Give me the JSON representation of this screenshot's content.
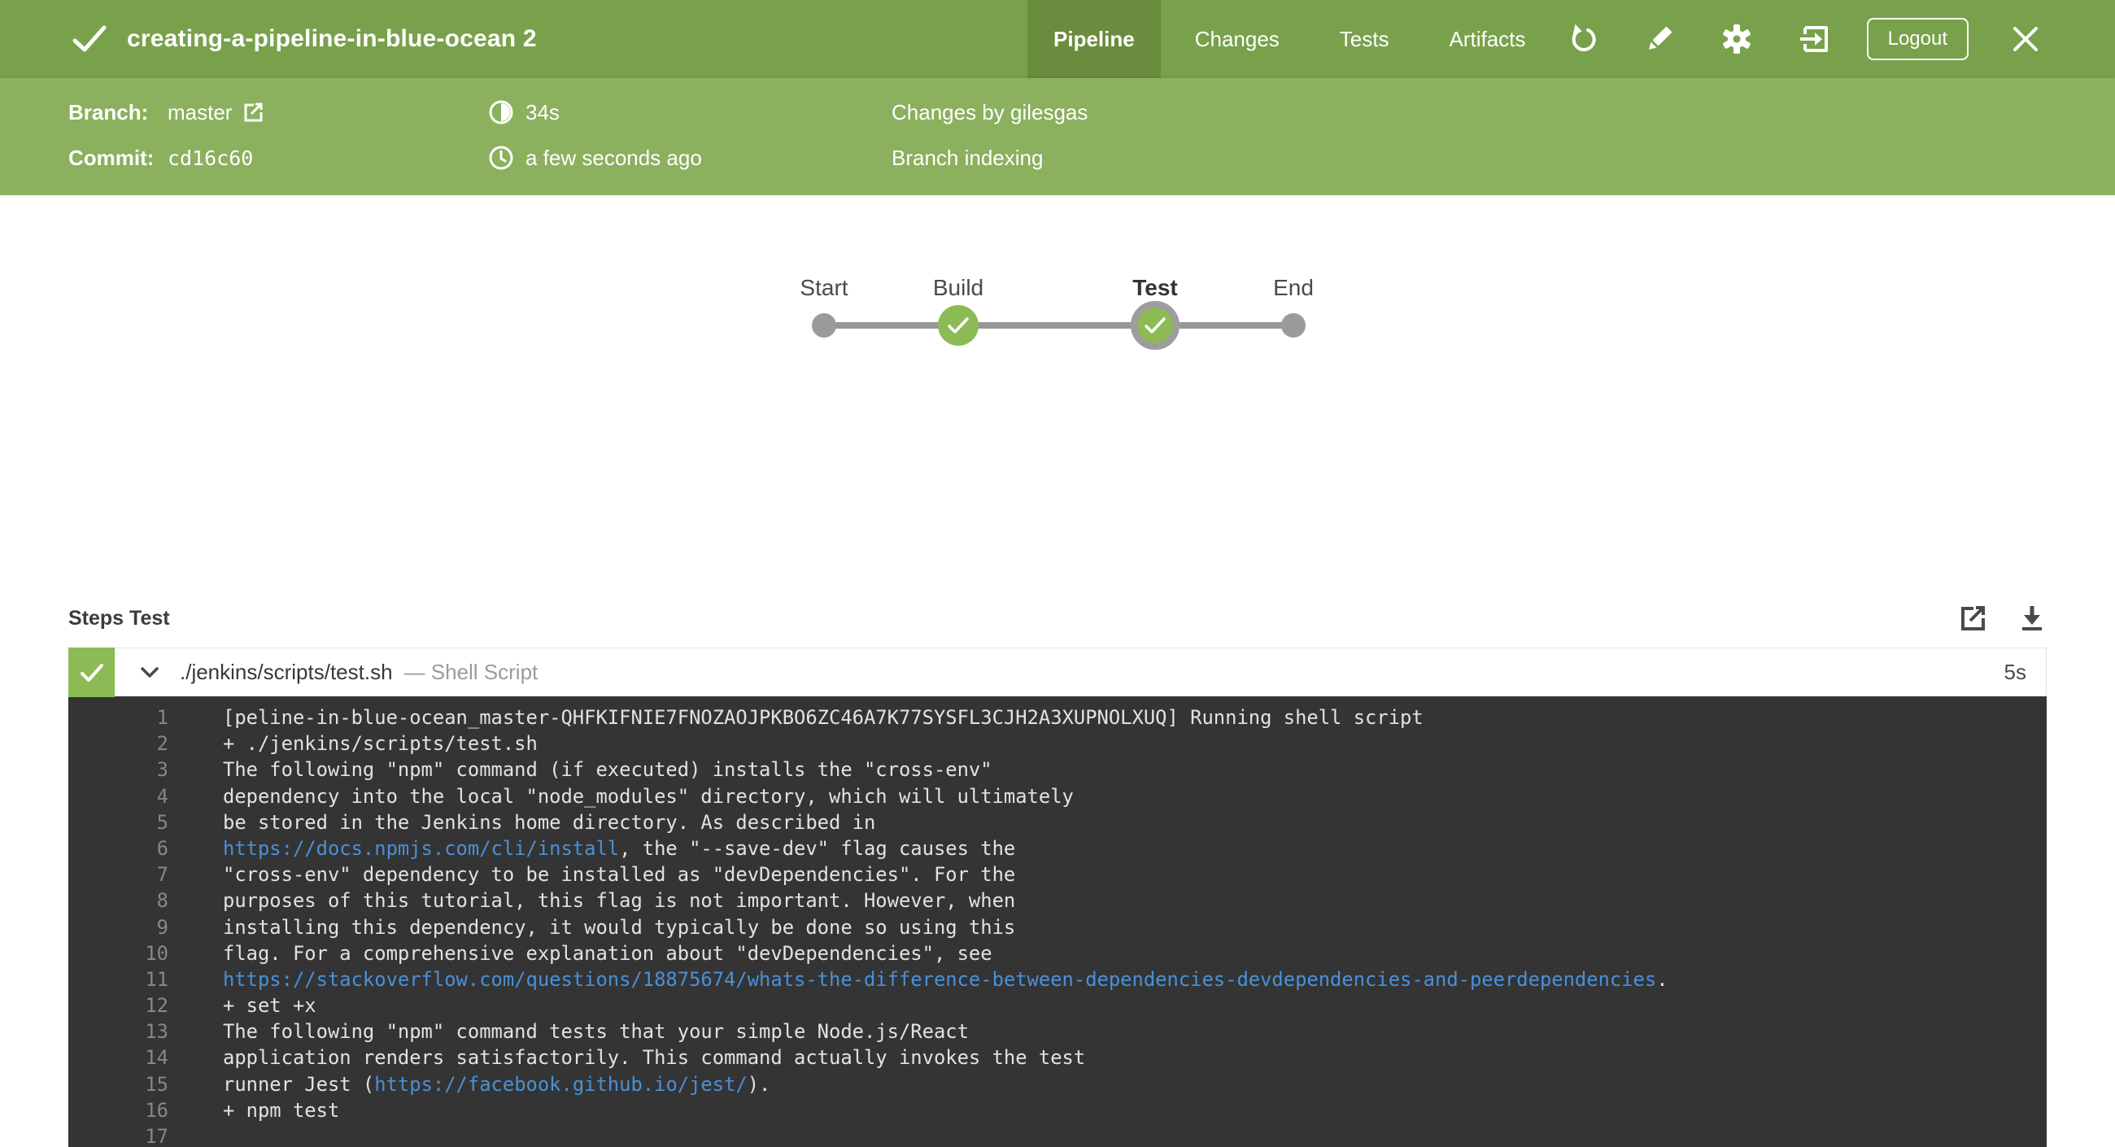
{
  "header": {
    "title": "creating-a-pipeline-in-blue-ocean 2",
    "tabs": [
      {
        "label": "Pipeline",
        "active": true
      },
      {
        "label": "Changes",
        "active": false
      },
      {
        "label": "Tests",
        "active": false
      },
      {
        "label": "Artifacts",
        "active": false
      }
    ],
    "logout_label": "Logout"
  },
  "run_info": {
    "branch_label": "Branch:",
    "branch_value": "master",
    "commit_label": "Commit:",
    "commit_value": "cd16c60",
    "duration": "34s",
    "time_ago": "a few seconds ago",
    "changes": "Changes by gilesgas",
    "cause": "Branch indexing"
  },
  "pipeline_graph": {
    "nodes": [
      {
        "label": "Start",
        "type": "terminal",
        "selected": false
      },
      {
        "label": "Build",
        "type": "success",
        "selected": false
      },
      {
        "label": "Test",
        "type": "success",
        "selected": true
      },
      {
        "label": "End",
        "type": "terminal",
        "selected": false
      }
    ]
  },
  "steps": {
    "heading": "Steps Test",
    "step": {
      "title": "./jenkins/scripts/test.sh",
      "subtitle": "— Shell Script",
      "duration": "5s"
    },
    "console_lines": [
      {
        "n": "1",
        "segments": [
          {
            "t": "[peline-in-blue-ocean_master-QHFKIFNIE7FNOZAOJPKBO6ZC46A7K77SYSFL3CJH2A3XUPNOLXUQ] Running shell script"
          }
        ]
      },
      {
        "n": "2",
        "segments": [
          {
            "t": "+ ./jenkins/scripts/test.sh"
          }
        ]
      },
      {
        "n": "3",
        "segments": [
          {
            "t": "The following \"npm\" command (if executed) installs the \"cross-env\""
          }
        ]
      },
      {
        "n": "4",
        "segments": [
          {
            "t": "dependency into the local \"node_modules\" directory, which will ultimately"
          }
        ]
      },
      {
        "n": "5",
        "segments": [
          {
            "t": "be stored in the Jenkins home directory. As described in"
          }
        ]
      },
      {
        "n": "6",
        "segments": [
          {
            "t": "https://docs.npmjs.com/cli/install",
            "link": true
          },
          {
            "t": ", the \"--save-dev\" flag causes the"
          }
        ]
      },
      {
        "n": "7",
        "segments": [
          {
            "t": "\"cross-env\" dependency to be installed as \"devDependencies\". For the"
          }
        ]
      },
      {
        "n": "8",
        "segments": [
          {
            "t": "purposes of this tutorial, this flag is not important. However, when"
          }
        ]
      },
      {
        "n": "9",
        "segments": [
          {
            "t": "installing this dependency, it would typically be done so using this"
          }
        ]
      },
      {
        "n": "10",
        "segments": [
          {
            "t": "flag. For a comprehensive explanation about \"devDependencies\", see"
          }
        ]
      },
      {
        "n": "11",
        "segments": [
          {
            "t": "https://stackoverflow.com/questions/18875674/whats-the-difference-between-dependencies-devdependencies-and-peerdependencies",
            "link": true
          },
          {
            "t": "."
          }
        ]
      },
      {
        "n": "12",
        "segments": [
          {
            "t": "+ set +x"
          }
        ]
      },
      {
        "n": "13",
        "segments": [
          {
            "t": "The following \"npm\" command tests that your simple Node.js/React"
          }
        ]
      },
      {
        "n": "14",
        "segments": [
          {
            "t": "application renders satisfactorily. This command actually invokes the test"
          }
        ]
      },
      {
        "n": "15",
        "segments": [
          {
            "t": "runner Jest ("
          },
          {
            "t": "https://facebook.github.io/jest/",
            "link": true
          },
          {
            "t": ")."
          }
        ]
      },
      {
        "n": "16",
        "segments": [
          {
            "t": "+ npm test"
          }
        ]
      },
      {
        "n": "17",
        "segments": []
      }
    ]
  },
  "colors": {
    "header_green": "#79A14B",
    "active_tab_green": "#6A8C3E",
    "subheader_green": "#8BB05E",
    "success_green": "#8CBA55",
    "node_gray": "#9B9B9B",
    "console_bg": "#343434",
    "console_text": "#E2E2E2",
    "link_blue": "#4A90D9"
  }
}
